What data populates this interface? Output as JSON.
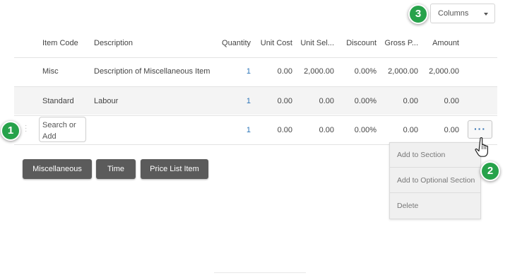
{
  "columns_select": {
    "label": "Columns",
    "icon": "caret-down-icon"
  },
  "table": {
    "headers": [
      "Item Code",
      "Description",
      "Quantity",
      "Unit Cost",
      "Unit Sel...",
      "Discount",
      "Gross P...",
      "Amount"
    ],
    "rows": [
      {
        "item_code": "Misc",
        "description": "Description of Miscellaneous Item",
        "quantity": "1",
        "unit_cost": "0.00",
        "unit_sell": "2,000.00",
        "discount": "0.00%",
        "gross_profit": "2,000.00",
        "amount": "2,000.00"
      },
      {
        "item_code": "Standard",
        "description": "Labour",
        "quantity": "1",
        "unit_cost": "0.00",
        "unit_sell": "0.00",
        "discount": "0.00%",
        "gross_profit": "0.00",
        "amount": "0.00"
      },
      {
        "item_code": "",
        "description": "",
        "quantity": "1",
        "unit_cost": "0.00",
        "unit_sell": "0.00",
        "discount": "0.00%",
        "gross_profit": "0.00",
        "amount": "0.00"
      }
    ]
  },
  "search": {
    "placeholder": "Search or\nAdd"
  },
  "more_button": {
    "label": "···"
  },
  "row_menu": {
    "items": [
      "Add to Section",
      "Add to Optional Section",
      "Delete"
    ]
  },
  "add_buttons": [
    "Miscellaneous",
    "Time",
    "Price List Item"
  ],
  "callouts": [
    "1",
    "2",
    "3"
  ],
  "colors": {
    "badge": "#27a24b",
    "button": "#5b5b5b",
    "link": "#2b74b8"
  }
}
